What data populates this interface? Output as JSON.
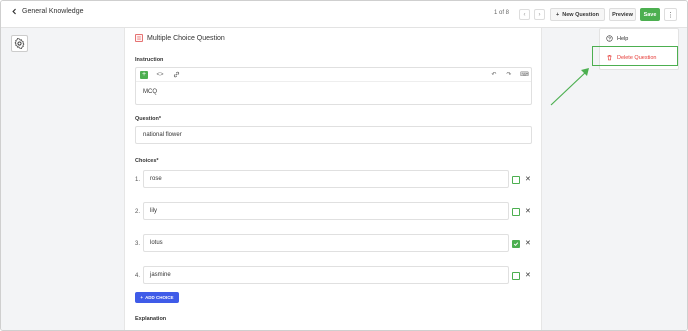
{
  "header": {
    "back_label": "General Knowledge",
    "pager": "1 of 8",
    "prev_symbol": "‹",
    "next_symbol": "›",
    "new_question_label": "New Question",
    "preview_label": "Preview",
    "save_label": "Save",
    "more_symbol": "⋮"
  },
  "question_type": {
    "label": "Multiple Choice Question",
    "icon": "mcq-list-icon"
  },
  "instruction": {
    "label": "Instruction",
    "value": "MCQ",
    "toolbar": {
      "add_symbol": "+",
      "code_symbol": "<>",
      "link_symbol": "🔗",
      "undo_symbol": "↶",
      "redo_symbol": "↷",
      "keyboard_symbol": "⌨"
    }
  },
  "question": {
    "label": "Question*",
    "value": "national flower"
  },
  "choices": {
    "label": "Choices*",
    "items": [
      {
        "num": "1.",
        "value": "rose",
        "checked": false
      },
      {
        "num": "2.",
        "value": "lily",
        "checked": false
      },
      {
        "num": "3.",
        "value": "lotus",
        "checked": true
      },
      {
        "num": "4.",
        "value": "jasmine",
        "checked": false
      }
    ],
    "add_label": "ADD CHOICE",
    "remove_symbol": "✕"
  },
  "explanation": {
    "label": "Explanation"
  },
  "menu": {
    "help_label": "Help",
    "delete_label": "Delete Question"
  },
  "colors": {
    "accent_green": "#4caf50",
    "accent_blue": "#3f5be8",
    "danger": "#e53935"
  }
}
